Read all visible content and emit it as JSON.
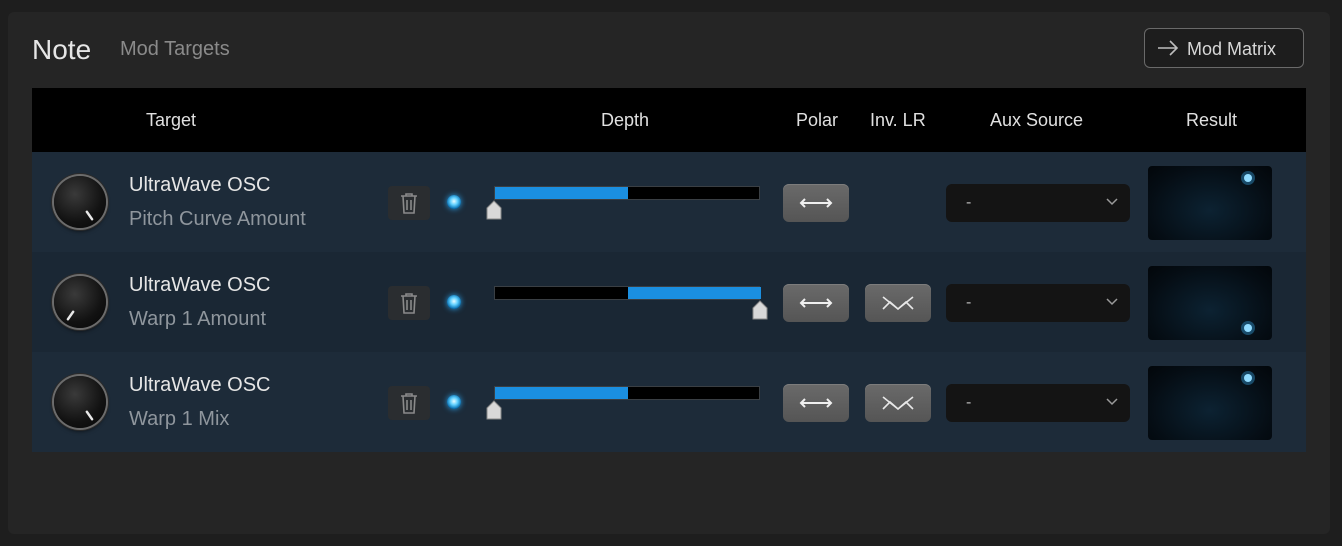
{
  "header": {
    "title": "Note",
    "subtitle": "Mod Targets",
    "mod_matrix_label": "Mod Matrix"
  },
  "columns": {
    "target": "Target",
    "depth": "Depth",
    "polar": "Polar",
    "inv_lr": "Inv. LR",
    "aux_source": "Aux Source",
    "result": "Result"
  },
  "rows": [
    {
      "name": "UltraWave OSC",
      "param": "Pitch Curve Amount",
      "depth": 0.5,
      "aux_source": "-",
      "has_inv_lr": false
    },
    {
      "name": "UltraWave OSC",
      "param": "Warp 1 Amount",
      "depth": -0.5,
      "aux_source": "-",
      "has_inv_lr": true
    },
    {
      "name": "UltraWave OSC",
      "param": "Warp 1 Mix",
      "depth": 0.5,
      "aux_source": "-",
      "has_inv_lr": true
    }
  ],
  "icons": {
    "mod_matrix": "arrow-right-icon",
    "delete": "trash-icon",
    "enabled": "led-icon",
    "polar": "double-arrow-icon",
    "inv_lr": "cross-wave-icon",
    "dropdown": "chevron-down-icon"
  },
  "colors": {
    "accent": "#1b8fe0",
    "led": "#5fd0ff",
    "header_bg": "#000000",
    "row_bg": "#1d2b39"
  }
}
